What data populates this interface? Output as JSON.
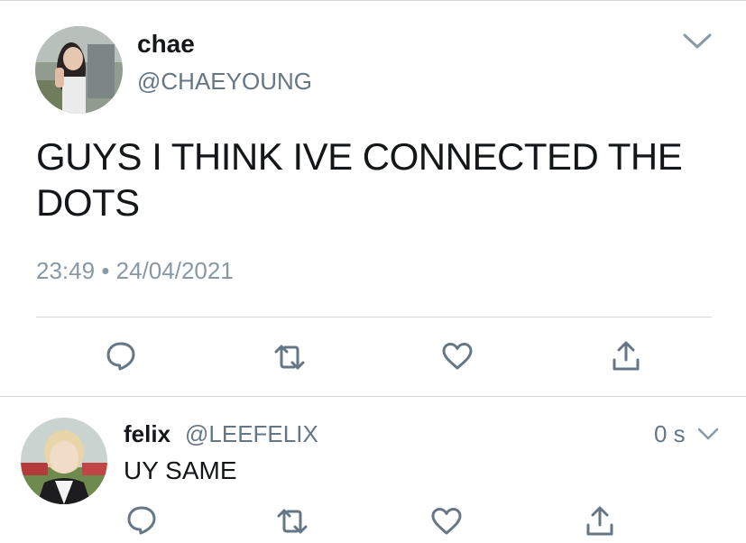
{
  "tweet": {
    "display_name": "chae",
    "handle": "@CHAEYOUNG",
    "text": "GUYS I THINK IVE CONNECTED THE DOTS",
    "time": "23:49",
    "separator": "•",
    "date": "24/04/2021",
    "actions": [
      "reply-icon",
      "retweet-icon",
      "like-icon",
      "share-icon"
    ]
  },
  "reply": {
    "display_name": "felix",
    "handle": "@LEEFELIX",
    "time_ago": "0 s",
    "text": "UY SAME",
    "actions": [
      "reply-icon",
      "retweet-icon",
      "like-icon",
      "share-icon"
    ]
  },
  "colors": {
    "primary_text": "#14171a",
    "secondary_text": "#657786",
    "timestamp_text": "#8899a6",
    "icon": "#657786",
    "divider": "#d6d6d6"
  }
}
